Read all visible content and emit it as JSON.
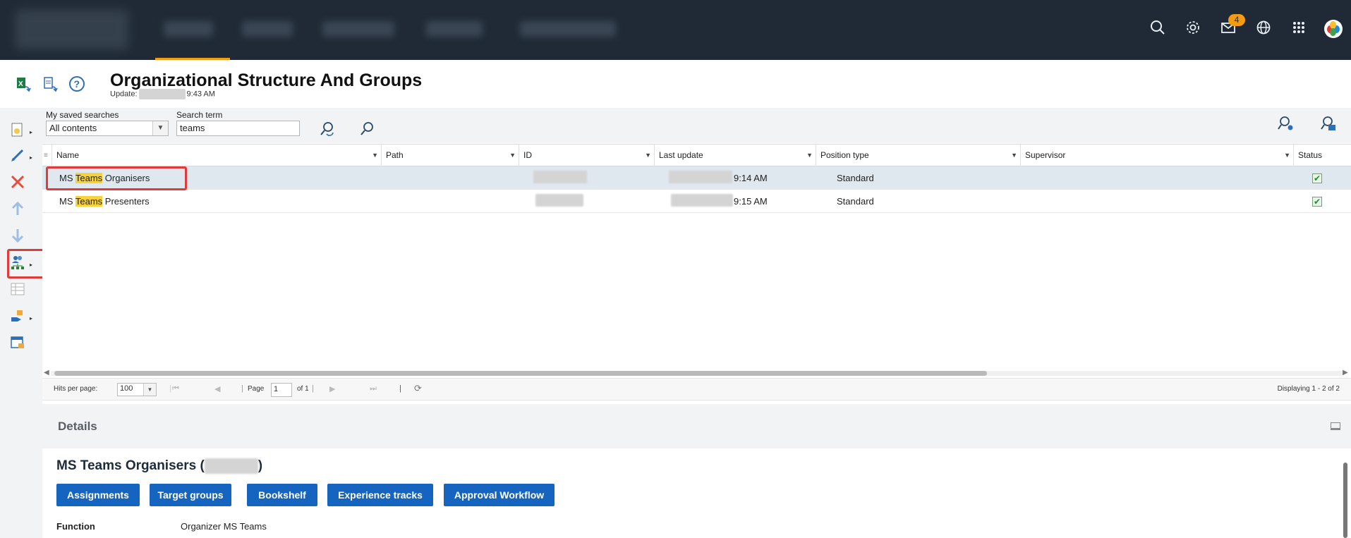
{
  "topbar": {
    "mail_badge": "4",
    "icons": [
      "search-icon",
      "gear-icon",
      "mail-icon",
      "globe-icon",
      "apps-grid-icon",
      "avatar"
    ]
  },
  "header": {
    "title": "Organizational Structure And Groups",
    "update_prefix": "Update:",
    "update_time": "9:43 AM"
  },
  "search": {
    "saved_label": "My saved searches",
    "saved_value": "All contents",
    "term_label": "Search term",
    "term_value": "teams"
  },
  "grid": {
    "columns": [
      "Name",
      "Path",
      "ID",
      "Last update",
      "Position type",
      "Supervisor",
      "Status"
    ],
    "rows": [
      {
        "name_pre": "MS ",
        "name_hl": "Teams",
        "name_post": " Organisers",
        "last_update": "9:14 AM",
        "position_type": "Standard",
        "status": "✔"
      },
      {
        "name_pre": "MS ",
        "name_hl": "Teams",
        "name_post": " Presenters",
        "last_update": "9:15 AM",
        "position_type": "Standard",
        "status": "✔"
      }
    ]
  },
  "pager": {
    "hits_label": "Hits per page:",
    "hits_value": "100",
    "page_label": "Page",
    "page_value": "1",
    "of_label": "of 1",
    "displaying": "Displaying 1 - 2 of 2"
  },
  "details": {
    "header": "Details",
    "title_pre": "MS Teams Organisers (",
    "title_post": ")",
    "buttons": [
      "Assignments",
      "Target groups",
      "Bookshelf",
      "Experience tracks",
      "Approval Workflow"
    ],
    "function_label": "Function",
    "function_value": "Organizer MS Teams"
  },
  "colors": {
    "topbar": "#1f2a36",
    "accent": "#f39c12",
    "primary_button": "#1565c0",
    "highlight": "#f7d23a",
    "selected_row": "#dfe7ef",
    "annotation_red": "#e03a3a"
  }
}
